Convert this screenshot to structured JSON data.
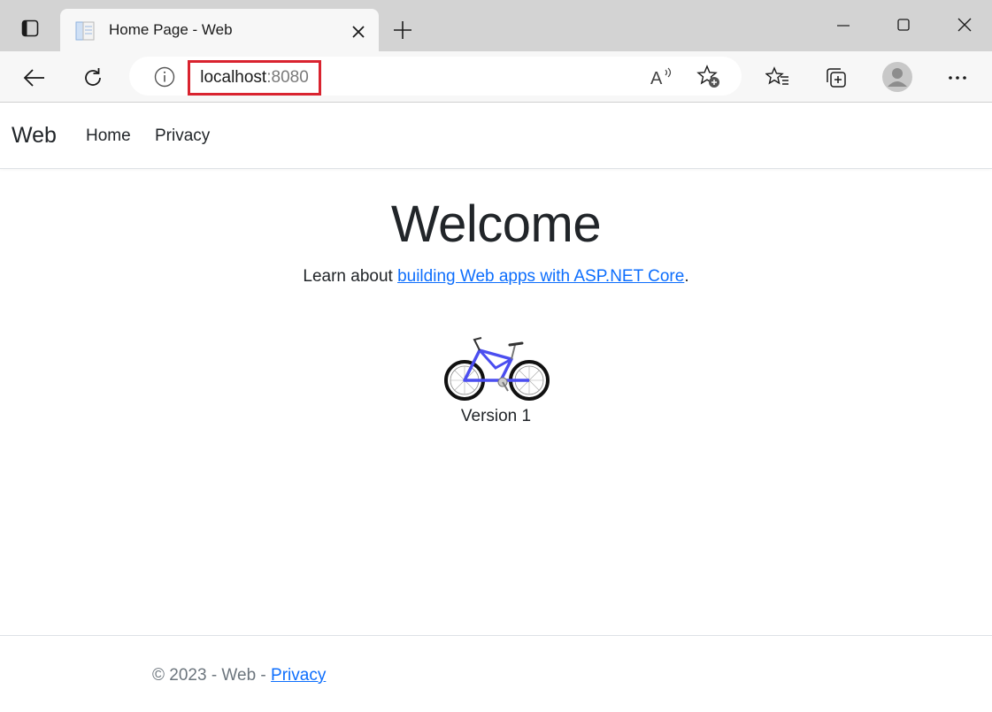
{
  "browser": {
    "tab": {
      "title": "Home Page - Web",
      "close_glyph": "✕"
    },
    "newtab_glyph": "+",
    "window": {
      "minimize_glyph": "—",
      "maximize_glyph": "☐",
      "close_glyph": "✕"
    },
    "address": {
      "host": "localhost",
      "port": ":8080"
    },
    "read_aloud_glyph": "A",
    "menu_glyph": "···"
  },
  "page": {
    "brand": "Web",
    "nav": [
      "Home",
      "Privacy"
    ],
    "heading": "Welcome",
    "learn_prefix": "Learn about ",
    "learn_link": "building Web apps with ASP.NET Core",
    "learn_suffix": ".",
    "version": "Version 1",
    "footer_prefix": "© 2023 - Web - ",
    "footer_link": "Privacy"
  },
  "colors": {
    "highlight_border": "#d9232f",
    "link": "#0d6efd",
    "bike_frame": "#4b4ef0"
  }
}
